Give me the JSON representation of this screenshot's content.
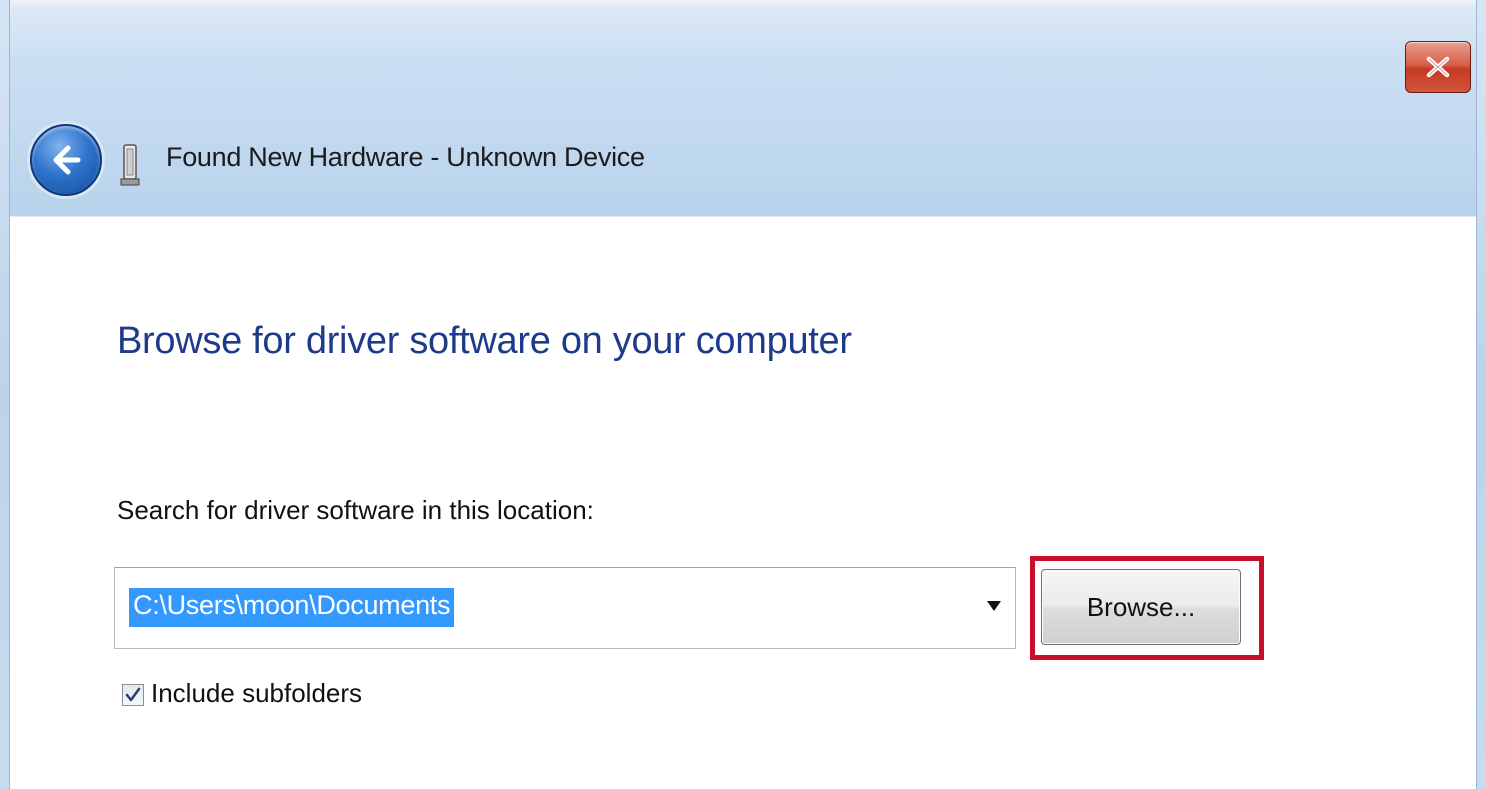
{
  "window": {
    "title": "Found New Hardware - Unknown Device"
  },
  "page": {
    "heading": "Browse for driver software on your computer",
    "location_label": "Search for driver software in this location:",
    "location_value": "C:\\Users\\moon\\Documents",
    "browse_label": "Browse...",
    "include_subfolders_label": "Include subfolders",
    "include_subfolders_checked": true
  },
  "icons": {
    "back": "back-arrow-icon",
    "device": "hardware-device-icon",
    "close": "close-icon",
    "dropdown": "chevron-down-icon",
    "check": "checkmark-icon"
  },
  "colors": {
    "heading": "#1e3a8a",
    "selection": "#3399ff",
    "highlight_box": "#c8102e",
    "close_button": "#c23a22"
  }
}
